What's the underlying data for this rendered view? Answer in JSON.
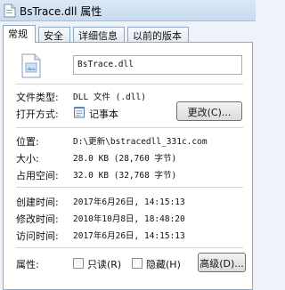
{
  "window": {
    "title": "BsTrace.dll 属性",
    "icon": "file-properties-icon"
  },
  "tabs": [
    {
      "label": "常规",
      "active": true
    },
    {
      "label": "安全",
      "active": false
    },
    {
      "label": "详细信息",
      "active": false
    },
    {
      "label": "以前的版本",
      "active": false
    }
  ],
  "general": {
    "file_name": "BsTrace.dll",
    "file_type_label": "文件类型:",
    "file_type_value": "DLL 文件 (.dll)",
    "opens_with_label": "打开方式:",
    "opens_with_value": "记事本",
    "change_button": "更改(C)...",
    "location_label": "位置:",
    "location_value": "D:\\更新\\bstracedll_331c.com",
    "size_label": "大小:",
    "size_value": "28.0 KB (28,760 字节)",
    "size_on_disk_label": "占用空间:",
    "size_on_disk_value": "32.0 KB (32,768 字节)",
    "created_label": "创建时间:",
    "created_value": "2017年6月26日, 14:15:13",
    "modified_label": "修改时间:",
    "modified_value": "2010年10月8日, 18:48:20",
    "accessed_label": "访问时间:",
    "accessed_value": "2017年6月26日, 14:15:13",
    "attributes_label": "属性:",
    "readonly_label": "只读(R)",
    "hidden_label": "隐藏(H)",
    "advanced_button": "高级(D)..."
  }
}
